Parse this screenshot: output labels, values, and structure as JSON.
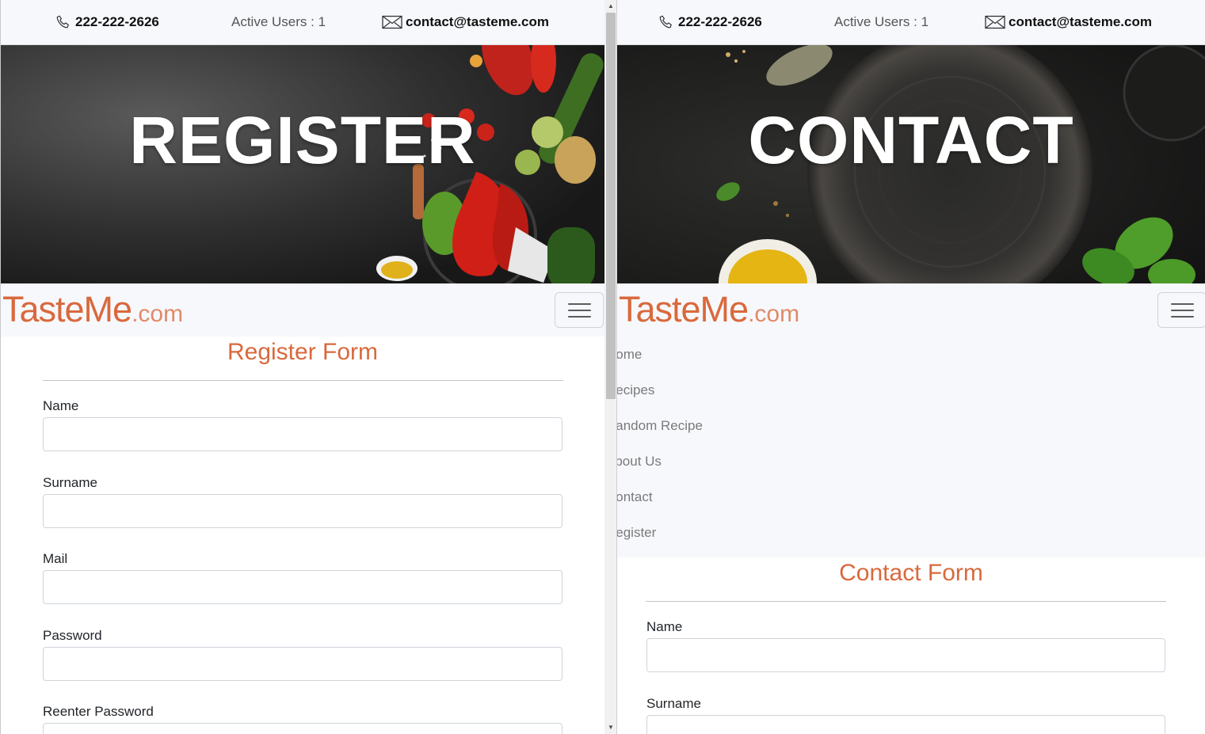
{
  "topbar": {
    "phone": "222-222-2626",
    "active_users": "Active Users : 1",
    "email": "contact@tasteme.com"
  },
  "brand": {
    "name": "TasteMe",
    "suffix": ".com",
    "color": "#d9693d"
  },
  "left_page": {
    "hero_title": "REGISTER",
    "form_title": "Register Form",
    "fields": [
      {
        "label": "Name",
        "value": ""
      },
      {
        "label": "Surname",
        "value": ""
      },
      {
        "label": "Mail",
        "value": ""
      },
      {
        "label": "Password",
        "value": ""
      },
      {
        "label": "Reenter Password",
        "value": ""
      }
    ]
  },
  "right_page": {
    "hero_title": "CONTACT",
    "menu_items": [
      "Home",
      "Recipes",
      "Random Recipe",
      "About Us",
      "Contact",
      "Register"
    ],
    "form_title": "Contact Form",
    "fields": [
      {
        "label": "Name",
        "value": ""
      },
      {
        "label": "Surname",
        "value": ""
      }
    ]
  },
  "icons": {
    "phone": "phone-icon",
    "mail": "envelope-icon",
    "menu": "hamburger-icon"
  },
  "colors": {
    "accent": "#d9693d",
    "bar_bg": "#f7f8fc"
  }
}
